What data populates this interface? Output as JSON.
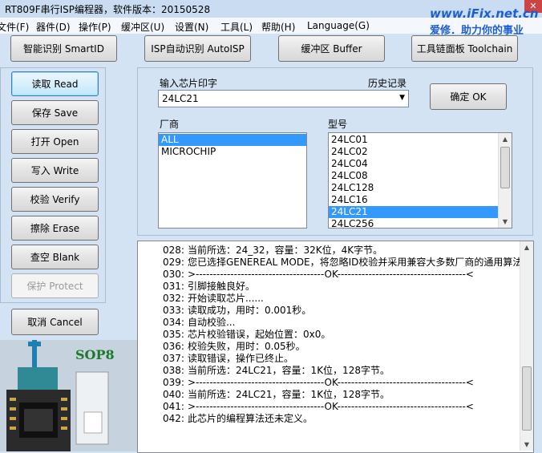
{
  "window": {
    "title": "RT809F串行ISP编程器，软件版本：20150528",
    "watermark_line1": "www.iFix.net.cn",
    "watermark_line2": "爱修．助力你的事业",
    "close_glyph": "✕"
  },
  "menu": [
    "文件(F)",
    "器件(D)",
    "操作(P)",
    "缓冲区(U)",
    "设置(N)",
    "工具(L)",
    "帮助(H)",
    "Language(G)"
  ],
  "toolbar": {
    "smartid": "智能识别 SmartID",
    "autoisp": "ISP自动识别 AutoISP",
    "buffer": "缓冲区 Buffer",
    "toolchain": "工具链面板 Toolchain"
  },
  "sidebar": {
    "read": "读取 Read",
    "save": "保存 Save",
    "open": "打开 Open",
    "write": "写入 Write",
    "verify": "校验 Verify",
    "erase": "擦除 Erase",
    "blank": "查空 Blank",
    "protect": "保护 Protect",
    "cancel": "取消 Cancel"
  },
  "chip_panel": {
    "input_label": "输入芯片印字",
    "history_label": "历史记录",
    "input_value": "24LC21",
    "ok_button": "确定 OK",
    "vendor_label": "厂商",
    "model_label": "型号",
    "vendors": [
      "ALL",
      "MICROCHIP"
    ],
    "models": [
      "24LC01",
      "24LC02",
      "24LC04",
      "24LC08",
      "24LC128",
      "24LC16",
      "24LC21",
      "24LC256"
    ]
  },
  "chip_image": {
    "package_label": "SOP8"
  },
  "log": [
    {
      "n": "028:",
      "t": "当前所选：24_32，容量：32K位，4K字节。"
    },
    {
      "n": "029:",
      "t": "您已选择GENEREAL MODE，将忽略ID校验并采用兼容大多数厂商的通用算法。"
    },
    {
      "n": "030:",
      "t": ">-------------------------------------OK-------------------------------------<"
    },
    {
      "n": "031:",
      "t": "引脚接触良好。"
    },
    {
      "n": "032:",
      "t": "开始读取芯片......"
    },
    {
      "n": "033:",
      "t": "读取成功，用时：0.001秒。"
    },
    {
      "n": "034:",
      "t": "自动校验..."
    },
    {
      "n": "035:",
      "t": "芯片校验错误，起始位置：0x0。"
    },
    {
      "n": "036:",
      "t": "校验失败，用时：0.05秒。"
    },
    {
      "n": "037:",
      "t": "读取错误，操作已终止。"
    },
    {
      "n": "038:",
      "t": "当前所选：24LC21，容量：1K位，128字节。"
    },
    {
      "n": "039:",
      "t": ">-------------------------------------OK-------------------------------------<"
    },
    {
      "n": "040:",
      "t": "当前所选：24LC21，容量：1K位，128字节。"
    },
    {
      "n": "041:",
      "t": ">-------------------------------------OK-------------------------------------<"
    },
    {
      "n": "042:",
      "t": "此芯片的编程算法还未定义。"
    }
  ]
}
